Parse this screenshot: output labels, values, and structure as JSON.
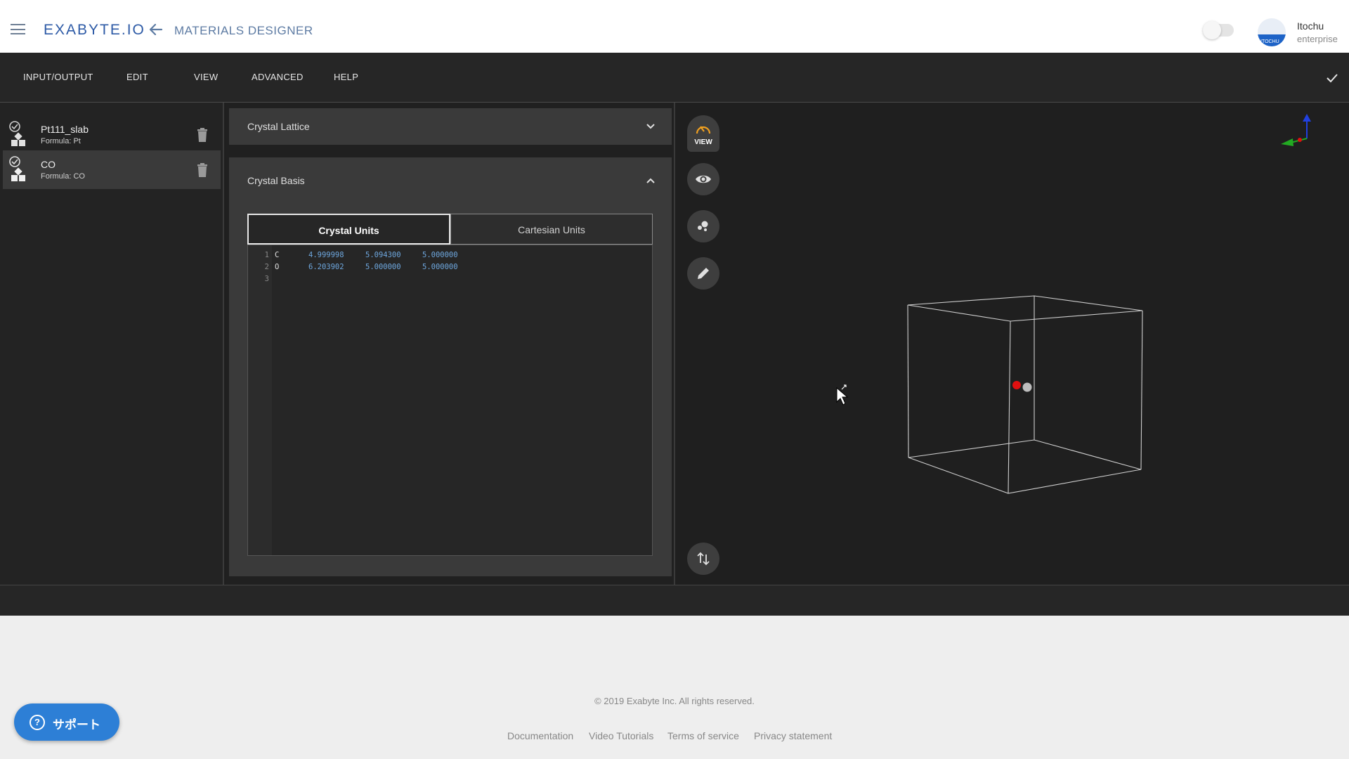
{
  "header": {
    "logo": "EXABYTE.IO",
    "page_title": "MATERIALS DESIGNER",
    "user_name": "Itochu",
    "user_role": "enterprise",
    "avatar_text": "ITOCHU"
  },
  "menu": {
    "items": [
      "INPUT/OUTPUT",
      "EDIT",
      "VIEW",
      "ADVANCED",
      "HELP"
    ]
  },
  "materials": [
    {
      "name": "Pt111_slab",
      "formula": "Formula: Pt",
      "active": false
    },
    {
      "name": "CO",
      "formula": "Formula: CO",
      "active": true
    }
  ],
  "crystal_lattice": {
    "title": "Crystal Lattice"
  },
  "crystal_basis": {
    "title": "Crystal Basis",
    "tabs": [
      "Crystal Units",
      "Cartesian Units"
    ],
    "active_tab": "Crystal Units",
    "lines": [
      {
        "n": "1",
        "el": "C",
        "x": "4.999998",
        "y": "5.094300",
        "z": "5.000000"
      },
      {
        "n": "2",
        "el": "O",
        "x": "6.203902",
        "y": "5.000000",
        "z": "5.000000"
      },
      {
        "n": "3",
        "el": "",
        "x": "",
        "y": "",
        "z": ""
      }
    ]
  },
  "viewer": {
    "view_label": "VIEW",
    "atom_colors": {
      "O": "#e01010",
      "C": "#bdbdbd"
    },
    "axis_colors": {
      "x": "#e01010",
      "y": "#22aa22",
      "z": "#2040e0"
    }
  },
  "footer": {
    "copyright": "© 2019 Exabyte Inc. All rights reserved.",
    "links": [
      "Documentation",
      "Video Tutorials",
      "Terms of service",
      "Privacy statement"
    ]
  },
  "support": {
    "label": "サポート"
  },
  "colors": {
    "brand": "#2d5aa6",
    "support": "#2d7fd6"
  }
}
